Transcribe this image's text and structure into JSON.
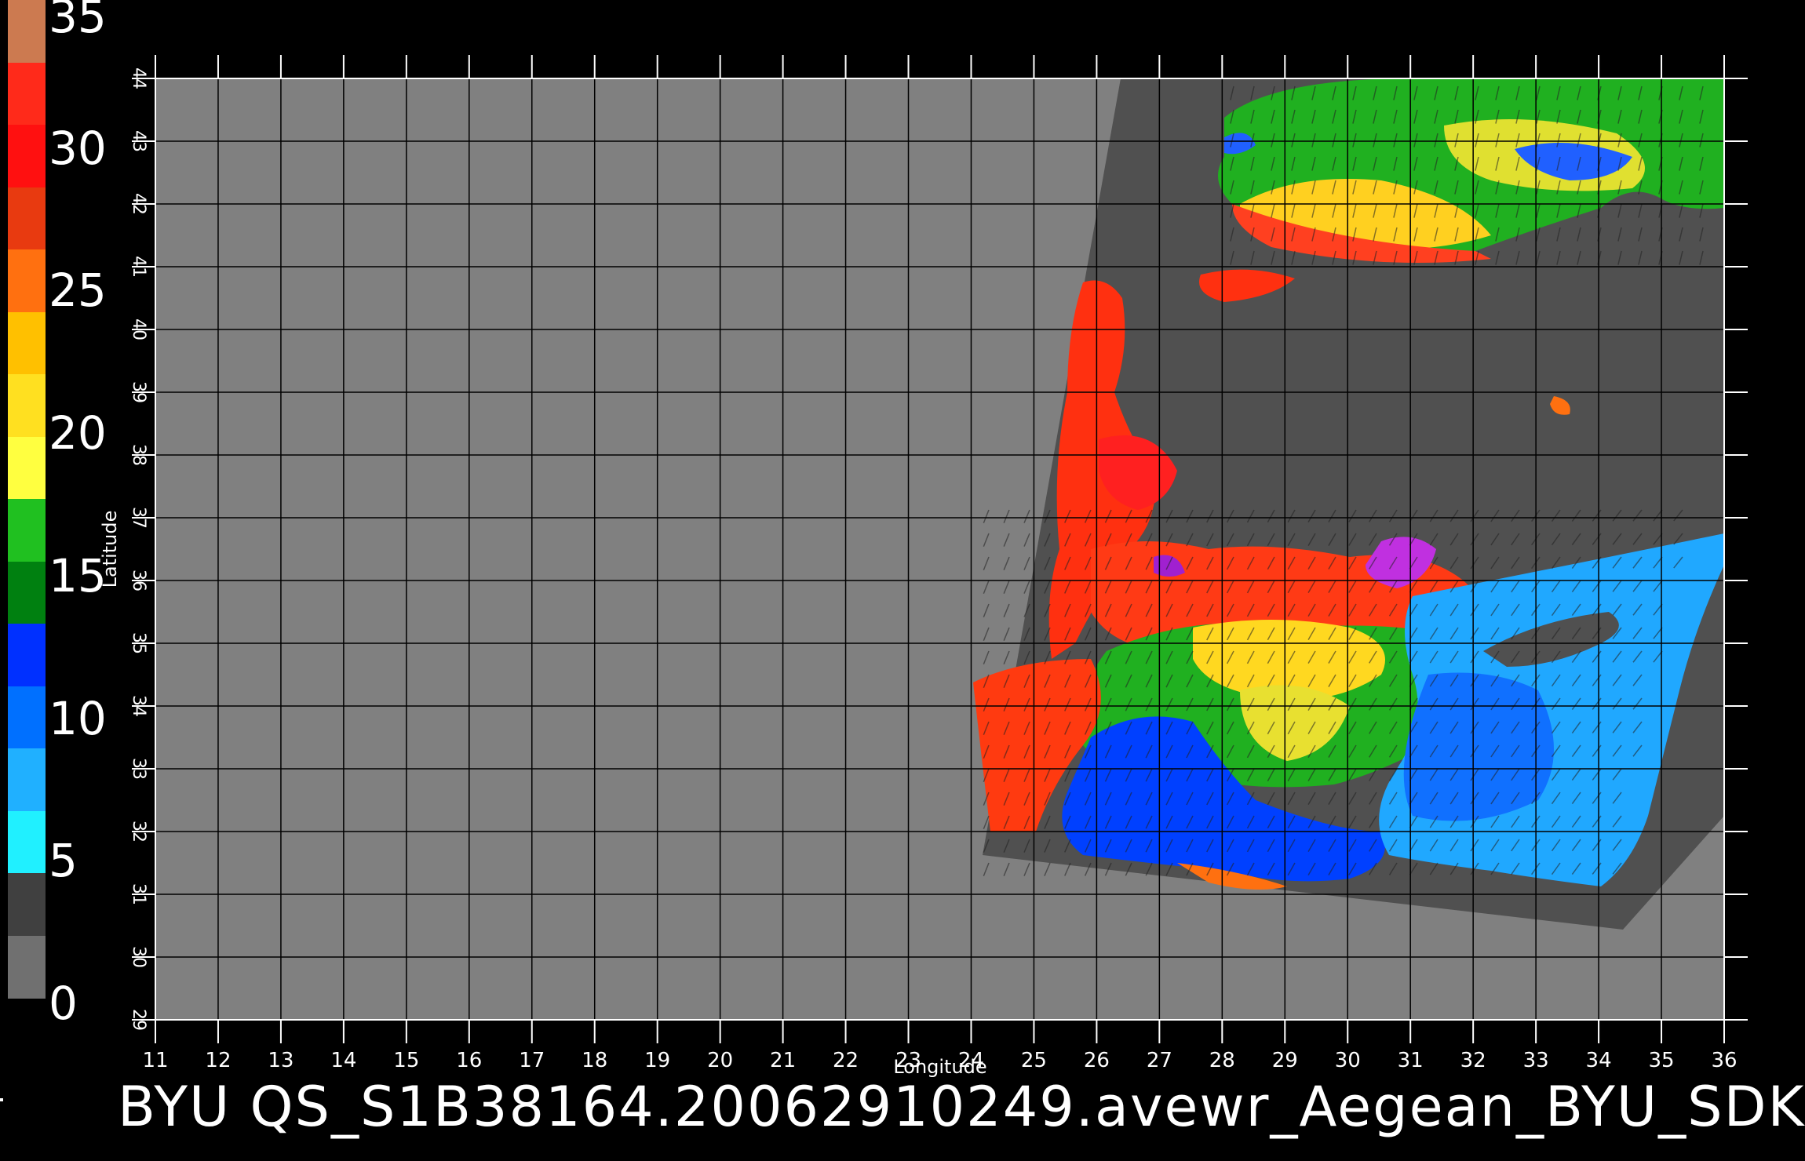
{
  "colorbar": {
    "labels": [
      "35",
      "30",
      "25",
      "20",
      "15",
      "10",
      "5",
      "0"
    ],
    "segments": [
      "#cc7a50",
      "#ff2a1a",
      "#ff1010",
      "#e83a10",
      "#ff7010",
      "#ffc000",
      "#ffe020",
      "#ffff40",
      "#20c020",
      "#008010",
      "#0030ff",
      "#0070ff",
      "#20b0ff",
      "#20f0ff",
      "#404040",
      "#707070"
    ]
  },
  "axes": {
    "xlabel": "Longitude",
    "ylabel": "Latitude",
    "xticks": [
      "11",
      "12",
      "13",
      "14",
      "15",
      "16",
      "17",
      "18",
      "19",
      "20",
      "21",
      "22",
      "23",
      "24",
      "25",
      "26",
      "27",
      "28",
      "29",
      "30",
      "31",
      "32",
      "33",
      "34",
      "35",
      "36"
    ],
    "yticks": [
      "29",
      "30",
      "31",
      "32",
      "33",
      "34",
      "35",
      "36",
      "37",
      "38",
      "39",
      "40",
      "41",
      "42",
      "43",
      "44"
    ],
    "xlim": [
      11,
      36
    ],
    "ylim": [
      29,
      44
    ]
  },
  "colors": {
    "background": "#000000",
    "map_fill": "#808080",
    "swath_fill": "#505050",
    "grid": "#000000"
  },
  "footer": {
    "title": "BYU  QS_S1B38164.20062910249.avewr_Aegean_BYU_SDK"
  }
}
